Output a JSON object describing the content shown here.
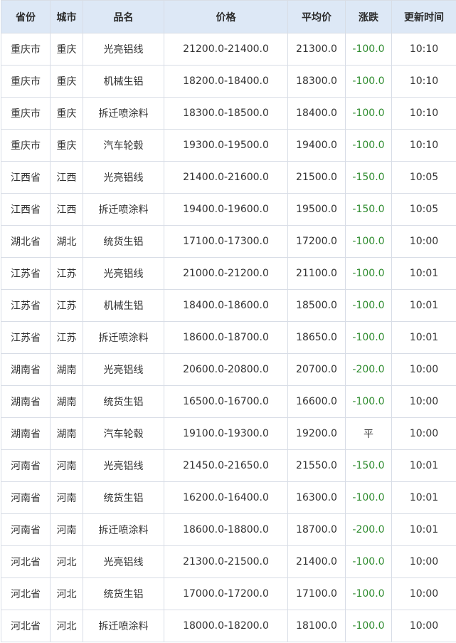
{
  "columns": [
    "省份",
    "城市",
    "品名",
    "价格",
    "平均价",
    "涨跌",
    "更新时间"
  ],
  "rows": [
    {
      "province": "重庆市",
      "city": "重庆",
      "product": "光亮铝线",
      "price": "21200.0-21400.0",
      "avg": "21300.0",
      "change": "-100.0",
      "time": "10:10"
    },
    {
      "province": "重庆市",
      "city": "重庆",
      "product": "机械生铝",
      "price": "18200.0-18400.0",
      "avg": "18300.0",
      "change": "-100.0",
      "time": "10:10"
    },
    {
      "province": "重庆市",
      "city": "重庆",
      "product": "拆迁喷涂料",
      "price": "18300.0-18500.0",
      "avg": "18400.0",
      "change": "-100.0",
      "time": "10:10"
    },
    {
      "province": "重庆市",
      "city": "重庆",
      "product": "汽车轮毂",
      "price": "19300.0-19500.0",
      "avg": "19400.0",
      "change": "-100.0",
      "time": "10:10"
    },
    {
      "province": "江西省",
      "city": "江西",
      "product": "光亮铝线",
      "price": "21400.0-21600.0",
      "avg": "21500.0",
      "change": "-150.0",
      "time": "10:05"
    },
    {
      "province": "江西省",
      "city": "江西",
      "product": "拆迁喷涂料",
      "price": "19400.0-19600.0",
      "avg": "19500.0",
      "change": "-150.0",
      "time": "10:05"
    },
    {
      "province": "湖北省",
      "city": "湖北",
      "product": "统货生铝",
      "price": "17100.0-17300.0",
      "avg": "17200.0",
      "change": "-100.0",
      "time": "10:00"
    },
    {
      "province": "江苏省",
      "city": "江苏",
      "product": "光亮铝线",
      "price": "21000.0-21200.0",
      "avg": "21100.0",
      "change": "-100.0",
      "time": "10:01"
    },
    {
      "province": "江苏省",
      "city": "江苏",
      "product": "机械生铝",
      "price": "18400.0-18600.0",
      "avg": "18500.0",
      "change": "-100.0",
      "time": "10:01"
    },
    {
      "province": "江苏省",
      "city": "江苏",
      "product": "拆迁喷涂料",
      "price": "18600.0-18700.0",
      "avg": "18650.0",
      "change": "-100.0",
      "time": "10:01"
    },
    {
      "province": "湖南省",
      "city": "湖南",
      "product": "光亮铝线",
      "price": "20600.0-20800.0",
      "avg": "20700.0",
      "change": "-200.0",
      "time": "10:00"
    },
    {
      "province": "湖南省",
      "city": "湖南",
      "product": "统货生铝",
      "price": "16500.0-16700.0",
      "avg": "16600.0",
      "change": "-100.0",
      "time": "10:00"
    },
    {
      "province": "湖南省",
      "city": "湖南",
      "product": "汽车轮毂",
      "price": "19100.0-19300.0",
      "avg": "19200.0",
      "change": "平",
      "time": "10:00"
    },
    {
      "province": "河南省",
      "city": "河南",
      "product": "光亮铝线",
      "price": "21450.0-21650.0",
      "avg": "21550.0",
      "change": "-150.0",
      "time": "10:01"
    },
    {
      "province": "河南省",
      "city": "河南",
      "product": "统货生铝",
      "price": "16200.0-16400.0",
      "avg": "16300.0",
      "change": "-100.0",
      "time": "10:01"
    },
    {
      "province": "河南省",
      "city": "河南",
      "product": "拆迁喷涂料",
      "price": "18600.0-18800.0",
      "avg": "18700.0",
      "change": "-200.0",
      "time": "10:01"
    },
    {
      "province": "河北省",
      "city": "河北",
      "product": "光亮铝线",
      "price": "21300.0-21500.0",
      "avg": "21400.0",
      "change": "-100.0",
      "time": "10:00"
    },
    {
      "province": "河北省",
      "city": "河北",
      "product": "统货生铝",
      "price": "17000.0-17200.0",
      "avg": "17100.0",
      "change": "-100.0",
      "time": "10:00"
    },
    {
      "province": "河北省",
      "city": "河北",
      "product": "拆迁喷涂料",
      "price": "18000.0-18200.0",
      "avg": "18100.0",
      "change": "-100.0",
      "time": "10:00"
    }
  ],
  "colors": {
    "header_bg": "#dde8f6",
    "border": "#d8dde6",
    "change_down": "#2e8b2e",
    "text": "#333333"
  }
}
